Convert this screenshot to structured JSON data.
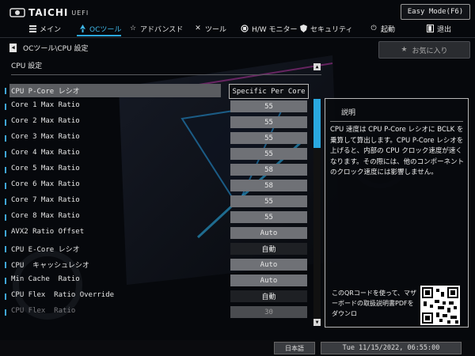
{
  "header": {
    "brand": "TAICHI",
    "brand_sub": "UEFI",
    "easy_mode_label": "Easy Mode(F6)"
  },
  "nav": {
    "items": [
      {
        "label": "メイン",
        "icon": "list-icon"
      },
      {
        "label": "OCツール",
        "icon": "rocket-icon",
        "active": true
      },
      {
        "label": "アドバンスド",
        "icon": "star-icon"
      },
      {
        "label": "ツール",
        "icon": "tools-icon"
      },
      {
        "label": "H/W モニター",
        "icon": "hw-monitor-icon"
      },
      {
        "label": "セキュリティ",
        "icon": "shield-icon"
      },
      {
        "label": "起動",
        "icon": "power-icon"
      },
      {
        "label": "退出",
        "icon": "exit-icon"
      }
    ]
  },
  "breadcrumb": "OCツール\\CPU 設定",
  "favorite_label": "お気に入り",
  "section_title": "CPU 設定",
  "settings": [
    {
      "label": "CPU P-Core レシオ",
      "value": "Specific Per Core"
    },
    {
      "label": "Core 1 Max Ratio",
      "value": "55"
    },
    {
      "label": "Core 2 Max Ratio",
      "value": "55"
    },
    {
      "label": "Core 3 Max Ratio",
      "value": "55"
    },
    {
      "label": "Core 4 Max Ratio",
      "value": "55"
    },
    {
      "label": "Core 5 Max Ratio",
      "value": "58"
    },
    {
      "label": "Core 6 Max Ratio",
      "value": "58"
    },
    {
      "label": "Core 7 Max Ratio",
      "value": "55"
    },
    {
      "label": "Core 8 Max Ratio",
      "value": "55"
    },
    {
      "label": "AVX2 Ratio Offset",
      "value": "Auto"
    },
    {
      "label": "CPU E-Core レシオ",
      "value": "自動"
    },
    {
      "label": "CPU  キャッシュレシオ",
      "value": "Auto"
    },
    {
      "label": "Min Cache  Ratio",
      "value": "Auto"
    },
    {
      "label": "CPU Flex  Ratio Override",
      "value": "自動"
    },
    {
      "label": "CPU Flex  Ratio",
      "value": "30"
    }
  ],
  "description": {
    "title": "説明",
    "body": "CPU 速度は CPU P-Core レシオに BCLK を乗算して算出します。CPU P-Core レシオを上げると、内部の CPU クロック速度が速くなります。その際には、他のコンポーネントのクロック速度には影響しません。",
    "qr_text": "このQRコードを使って、マザーボードの取扱説明書PDFをダウンロ"
  },
  "status": {
    "language": "日本語",
    "datetime": "Tue 11/15/2022, 06:55:00"
  },
  "colors": {
    "accent": "#2aa8e0",
    "background": "#06080c"
  }
}
